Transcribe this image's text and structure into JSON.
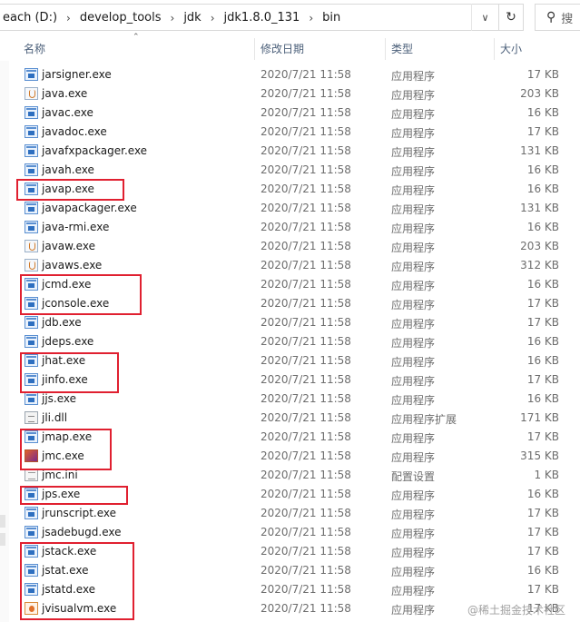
{
  "address": {
    "crumbs": [
      "each (D:)",
      "develop_tools",
      "jdk",
      "jdk1.8.0_131",
      "bin"
    ],
    "separator": "›"
  },
  "search": {
    "placeholder": "搜"
  },
  "columns": {
    "name": "名称",
    "date": "修改日期",
    "type": "类型",
    "size": "大小"
  },
  "files": [
    {
      "name": "jarsigner.exe",
      "date": "2020/7/21 11:58",
      "type": "应用程序",
      "size": "17 KB",
      "icon": "exe"
    },
    {
      "name": "java.exe",
      "date": "2020/7/21 11:58",
      "type": "应用程序",
      "size": "203 KB",
      "icon": "java"
    },
    {
      "name": "javac.exe",
      "date": "2020/7/21 11:58",
      "type": "应用程序",
      "size": "16 KB",
      "icon": "exe"
    },
    {
      "name": "javadoc.exe",
      "date": "2020/7/21 11:58",
      "type": "应用程序",
      "size": "17 KB",
      "icon": "exe"
    },
    {
      "name": "javafxpackager.exe",
      "date": "2020/7/21 11:58",
      "type": "应用程序",
      "size": "131 KB",
      "icon": "exe"
    },
    {
      "name": "javah.exe",
      "date": "2020/7/21 11:58",
      "type": "应用程序",
      "size": "16 KB",
      "icon": "exe"
    },
    {
      "name": "javap.exe",
      "date": "2020/7/21 11:58",
      "type": "应用程序",
      "size": "16 KB",
      "icon": "exe"
    },
    {
      "name": "javapackager.exe",
      "date": "2020/7/21 11:58",
      "type": "应用程序",
      "size": "131 KB",
      "icon": "exe"
    },
    {
      "name": "java-rmi.exe",
      "date": "2020/7/21 11:58",
      "type": "应用程序",
      "size": "16 KB",
      "icon": "exe"
    },
    {
      "name": "javaw.exe",
      "date": "2020/7/21 11:58",
      "type": "应用程序",
      "size": "203 KB",
      "icon": "java"
    },
    {
      "name": "javaws.exe",
      "date": "2020/7/21 11:58",
      "type": "应用程序",
      "size": "312 KB",
      "icon": "java"
    },
    {
      "name": "jcmd.exe",
      "date": "2020/7/21 11:58",
      "type": "应用程序",
      "size": "16 KB",
      "icon": "exe"
    },
    {
      "name": "jconsole.exe",
      "date": "2020/7/21 11:58",
      "type": "应用程序",
      "size": "17 KB",
      "icon": "exe"
    },
    {
      "name": "jdb.exe",
      "date": "2020/7/21 11:58",
      "type": "应用程序",
      "size": "17 KB",
      "icon": "exe"
    },
    {
      "name": "jdeps.exe",
      "date": "2020/7/21 11:58",
      "type": "应用程序",
      "size": "16 KB",
      "icon": "exe"
    },
    {
      "name": "jhat.exe",
      "date": "2020/7/21 11:58",
      "type": "应用程序",
      "size": "16 KB",
      "icon": "exe"
    },
    {
      "name": "jinfo.exe",
      "date": "2020/7/21 11:58",
      "type": "应用程序",
      "size": "17 KB",
      "icon": "exe"
    },
    {
      "name": "jjs.exe",
      "date": "2020/7/21 11:58",
      "type": "应用程序",
      "size": "16 KB",
      "icon": "exe"
    },
    {
      "name": "jli.dll",
      "date": "2020/7/21 11:58",
      "type": "应用程序扩展",
      "size": "171 KB",
      "icon": "dll"
    },
    {
      "name": "jmap.exe",
      "date": "2020/7/21 11:58",
      "type": "应用程序",
      "size": "17 KB",
      "icon": "exe"
    },
    {
      "name": "jmc.exe",
      "date": "2020/7/21 11:58",
      "type": "应用程序",
      "size": "315 KB",
      "icon": "jmc"
    },
    {
      "name": "jmc.ini",
      "date": "2020/7/21 11:58",
      "type": "配置设置",
      "size": "1 KB",
      "icon": "ini"
    },
    {
      "name": "jps.exe",
      "date": "2020/7/21 11:58",
      "type": "应用程序",
      "size": "16 KB",
      "icon": "exe"
    },
    {
      "name": "jrunscript.exe",
      "date": "2020/7/21 11:58",
      "type": "应用程序",
      "size": "17 KB",
      "icon": "exe"
    },
    {
      "name": "jsadebugd.exe",
      "date": "2020/7/21 11:58",
      "type": "应用程序",
      "size": "17 KB",
      "icon": "exe"
    },
    {
      "name": "jstack.exe",
      "date": "2020/7/21 11:58",
      "type": "应用程序",
      "size": "17 KB",
      "icon": "exe"
    },
    {
      "name": "jstat.exe",
      "date": "2020/7/21 11:58",
      "type": "应用程序",
      "size": "16 KB",
      "icon": "exe"
    },
    {
      "name": "jstatd.exe",
      "date": "2020/7/21 11:58",
      "type": "应用程序",
      "size": "17 KB",
      "icon": "exe"
    },
    {
      "name": "jvisualvm.exe",
      "date": "2020/7/21 11:58",
      "type": "应用程序",
      "size": "17 KB",
      "icon": "jvv"
    }
  ],
  "watermark": "@稀土掘金技术社区",
  "colors": {
    "highlight": "#e02030",
    "header_text": "#4c607a",
    "secondary_text": "#6d6d6d"
  }
}
